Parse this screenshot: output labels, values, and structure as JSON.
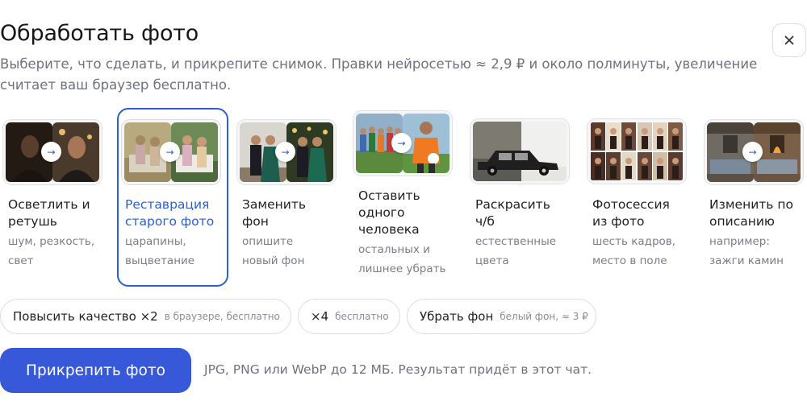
{
  "header": {
    "title": "Обработать фото",
    "subtitle_line1": "Выберите, что сделать, и прикрепите снимок. Правки нейросетью ≈ 2,9 ₽ и около полминуты, увеличение",
    "subtitle_line2": "считает ваш браузер бесплатно."
  },
  "close_icon": "close-icon",
  "cards": [
    {
      "title_lines": [
        "Осветлить и",
        "ретушь"
      ],
      "desc_lines": [
        "шум, резкость,",
        "свет"
      ],
      "selected": false
    },
    {
      "title_lines": [
        "Реставрация",
        "старого фото"
      ],
      "desc_lines": [
        "царапины,",
        "выцветание"
      ],
      "selected": true
    },
    {
      "title_lines": [
        "Заменить",
        "фон"
      ],
      "desc_lines": [
        "опишите",
        "новый фон"
      ],
      "selected": false
    },
    {
      "title_lines": [
        "Оставить",
        "одного",
        "человека"
      ],
      "desc_lines": [
        "остальных и",
        "лишнее убрать"
      ],
      "selected": false
    },
    {
      "title_lines": [
        "Раскрасить",
        "ч/б"
      ],
      "desc_lines": [
        "естественные",
        "цвета"
      ],
      "selected": false
    },
    {
      "title_lines": [
        "Фотосессия",
        "из фото"
      ],
      "desc_lines": [
        "шесть кадров,",
        "место в поле"
      ],
      "selected": false
    },
    {
      "title_lines": [
        "Изменить по",
        "описанию"
      ],
      "desc_lines": [
        "например:",
        "зажги камин"
      ],
      "selected": false
    }
  ],
  "arrow_glyph": "→",
  "chips": [
    {
      "label": "Повысить качество ×2",
      "hint": "в браузере, бесплатно"
    },
    {
      "label": "×4",
      "hint": "бесплатно"
    },
    {
      "label": "Убрать фон",
      "hint": "белый фон, ≈ 3 ₽"
    }
  ],
  "footer": {
    "attach_label": "Прикрепить фото",
    "note": "JPG, PNG или WebP до 12 МБ. Результат придёт в этот чат."
  },
  "colors": {
    "accent": "#3758d9",
    "selected_border": "#2a5fd6",
    "muted": "#6f7180"
  }
}
